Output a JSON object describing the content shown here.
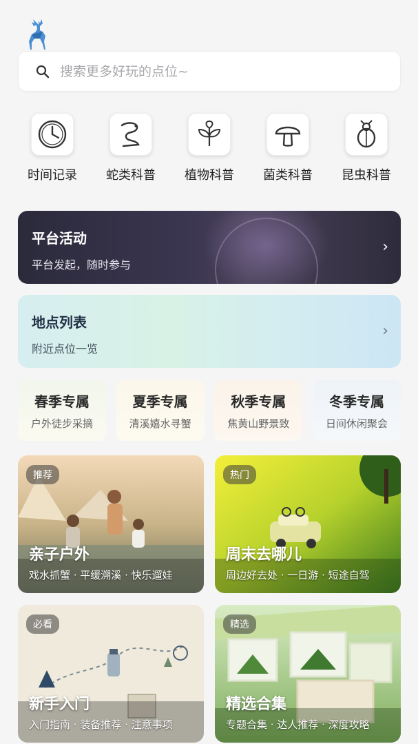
{
  "search": {
    "placeholder": "搜索更多好玩的点位~"
  },
  "categories": [
    {
      "label": "时间记录",
      "icon": "clock-icon"
    },
    {
      "label": "蛇类科普",
      "icon": "snake-icon"
    },
    {
      "label": "植物科普",
      "icon": "plant-icon"
    },
    {
      "label": "菌类科普",
      "icon": "mushroom-icon"
    },
    {
      "label": "昆虫科普",
      "icon": "insect-icon"
    }
  ],
  "banners": {
    "activity": {
      "title": "平台活动",
      "subtitle": "平台发起，随时参与"
    },
    "places": {
      "title": "地点列表",
      "subtitle": "附近点位一览"
    }
  },
  "seasons": [
    {
      "title": "春季专属",
      "subtitle": "户外徒步采摘"
    },
    {
      "title": "夏季专属",
      "subtitle": "清溪嬉水寻蟹"
    },
    {
      "title": "秋季专属",
      "subtitle": "焦黄山野景致"
    },
    {
      "title": "冬季专属",
      "subtitle": "日间休闲聚会"
    }
  ],
  "cards": [
    {
      "tag": "推荐",
      "title": "亲子户外",
      "subtitle": "戏水抓蟹 · 平缓溯溪 · 快乐遛娃"
    },
    {
      "tag": "热门",
      "title": "周末去哪儿",
      "subtitle": "周边好去处 · 一日游 · 短途自驾"
    },
    {
      "tag": "必看",
      "title": "新手入门",
      "subtitle": "入门指南 · 装备推荐 · 注意事项"
    },
    {
      "tag": "精选",
      "title": "精选合集",
      "subtitle": "专题合集 · 达人推荐 · 深度攻略"
    }
  ],
  "colors": {
    "accent": "#3d7fc4",
    "activity_banner": "#2b2a3a",
    "places_banner": "#d7eef0"
  }
}
